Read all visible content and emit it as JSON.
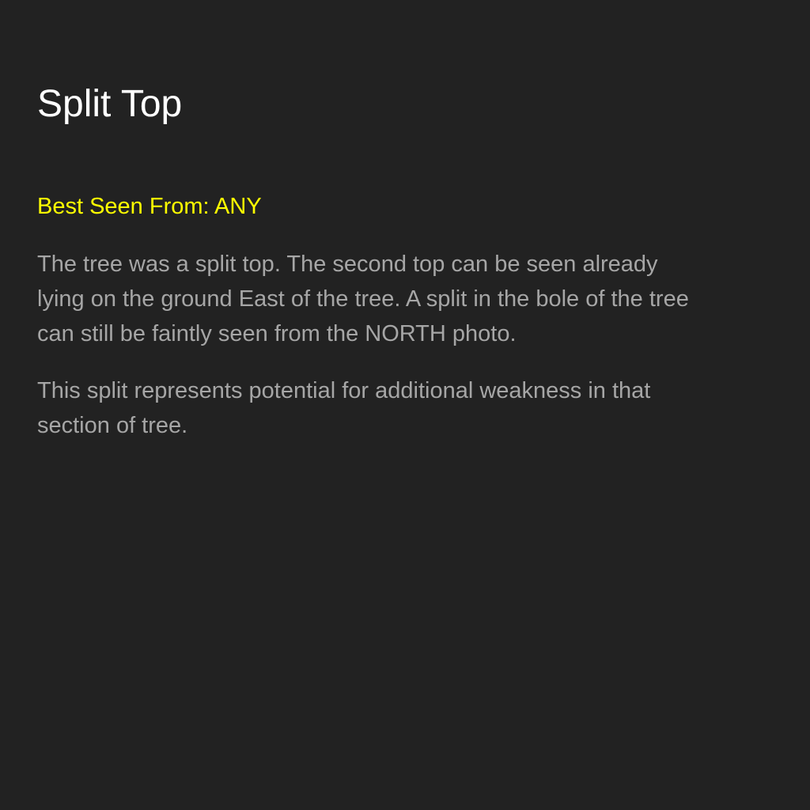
{
  "colors": {
    "background": "#222222",
    "title": "#ffffff",
    "highlight": "#ffff00",
    "body_text": "#a6a6a6"
  },
  "slide": {
    "title": "Split Top",
    "best_seen": "Best Seen From: ANY",
    "paragraphs": [
      "The tree was a split top.  The second top can be seen already\nlying on the ground East of the tree.  A split in the bole of the tree\ncan still be faintly seen from the NORTH photo.",
      "This split represents potential for additional weakness in that\nsection of tree."
    ]
  }
}
